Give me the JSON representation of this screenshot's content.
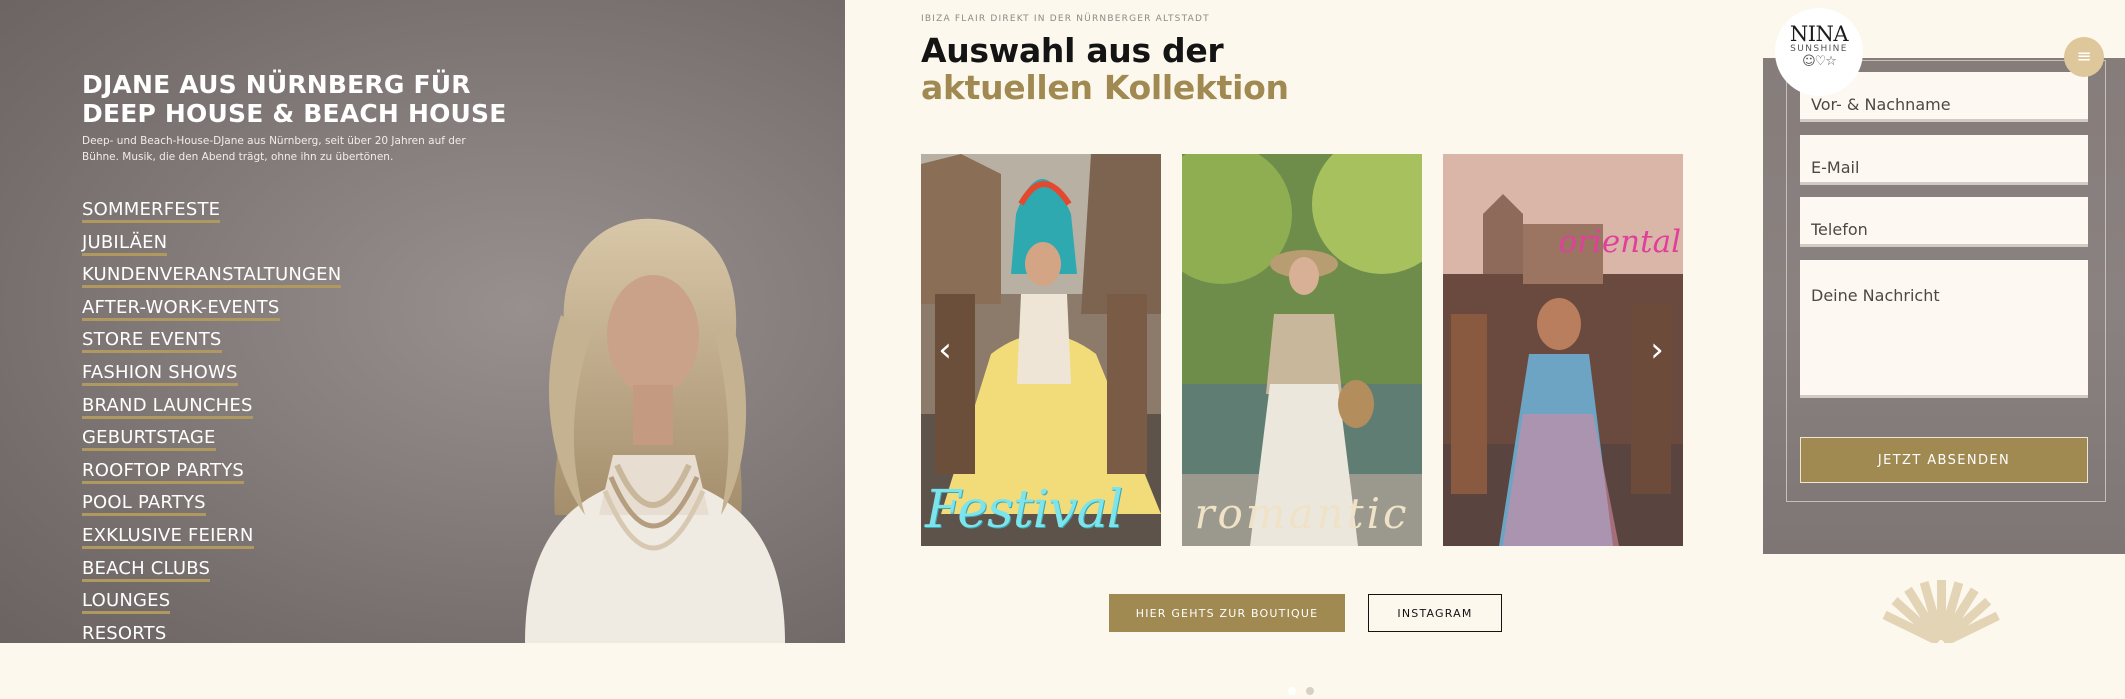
{
  "dj": {
    "title": "DJANE AUS NÜRNBERG FÜR DEEP HOUSE & BEACH HOUSE",
    "description": "Deep- und Beach-House-DJane aus Nürnberg, seit über 20 Jahren auf der Bühne. Musik, die den Abend trägt, ohne ihn zu übertönen.",
    "events": [
      "SOMMERFESTE",
      "JUBILÄEN",
      "KUNDENVERANSTALTUNGEN",
      "AFTER-WORK-EVENTS",
      "STORE EVENTS",
      "FASHION SHOWS",
      "BRAND LAUNCHES",
      "GEBURTSTAGE",
      "ROOFTOP PARTYS",
      "POOL PARTYS",
      "EXKLUSIVE FEIERN",
      "BEACH CLUBS",
      "LOUNGES",
      "RESORTS"
    ]
  },
  "collection": {
    "eyebrow": "IBIZA FLAIR DIREKT IN DER NÜRNBERGER ALTSTADT",
    "title_plain": "Auswahl aus der ",
    "title_accent": "aktuellen Kollektion",
    "slides": [
      {
        "caption": "Festival"
      },
      {
        "caption": "romantic"
      },
      {
        "caption": "oriental"
      }
    ],
    "prev_arrow": "‹",
    "next_arrow": "›",
    "dots_active_index": 0,
    "boutique_button": "HIER GEHTS ZUR BOUTIQUE",
    "instagram_button": "INSTAGRAM"
  },
  "contact": {
    "logo_line1": "NINA",
    "logo_line2": "SUNSHINE",
    "logo_line3": "☺♡☆",
    "menu_icon": "≡",
    "fields": {
      "name_placeholder": "Vor- & Nachname",
      "email_placeholder": "E-Mail",
      "phone_placeholder": "Telefon",
      "message_placeholder": "Deine Nachricht"
    },
    "submit_label": "JETZT ABSENDEN"
  },
  "colors": {
    "accent_gold": "#a18a52",
    "cream_background": "#fdf8ee",
    "caption_festival": "#7ee4ec",
    "caption_oriental": "#e0409b"
  }
}
